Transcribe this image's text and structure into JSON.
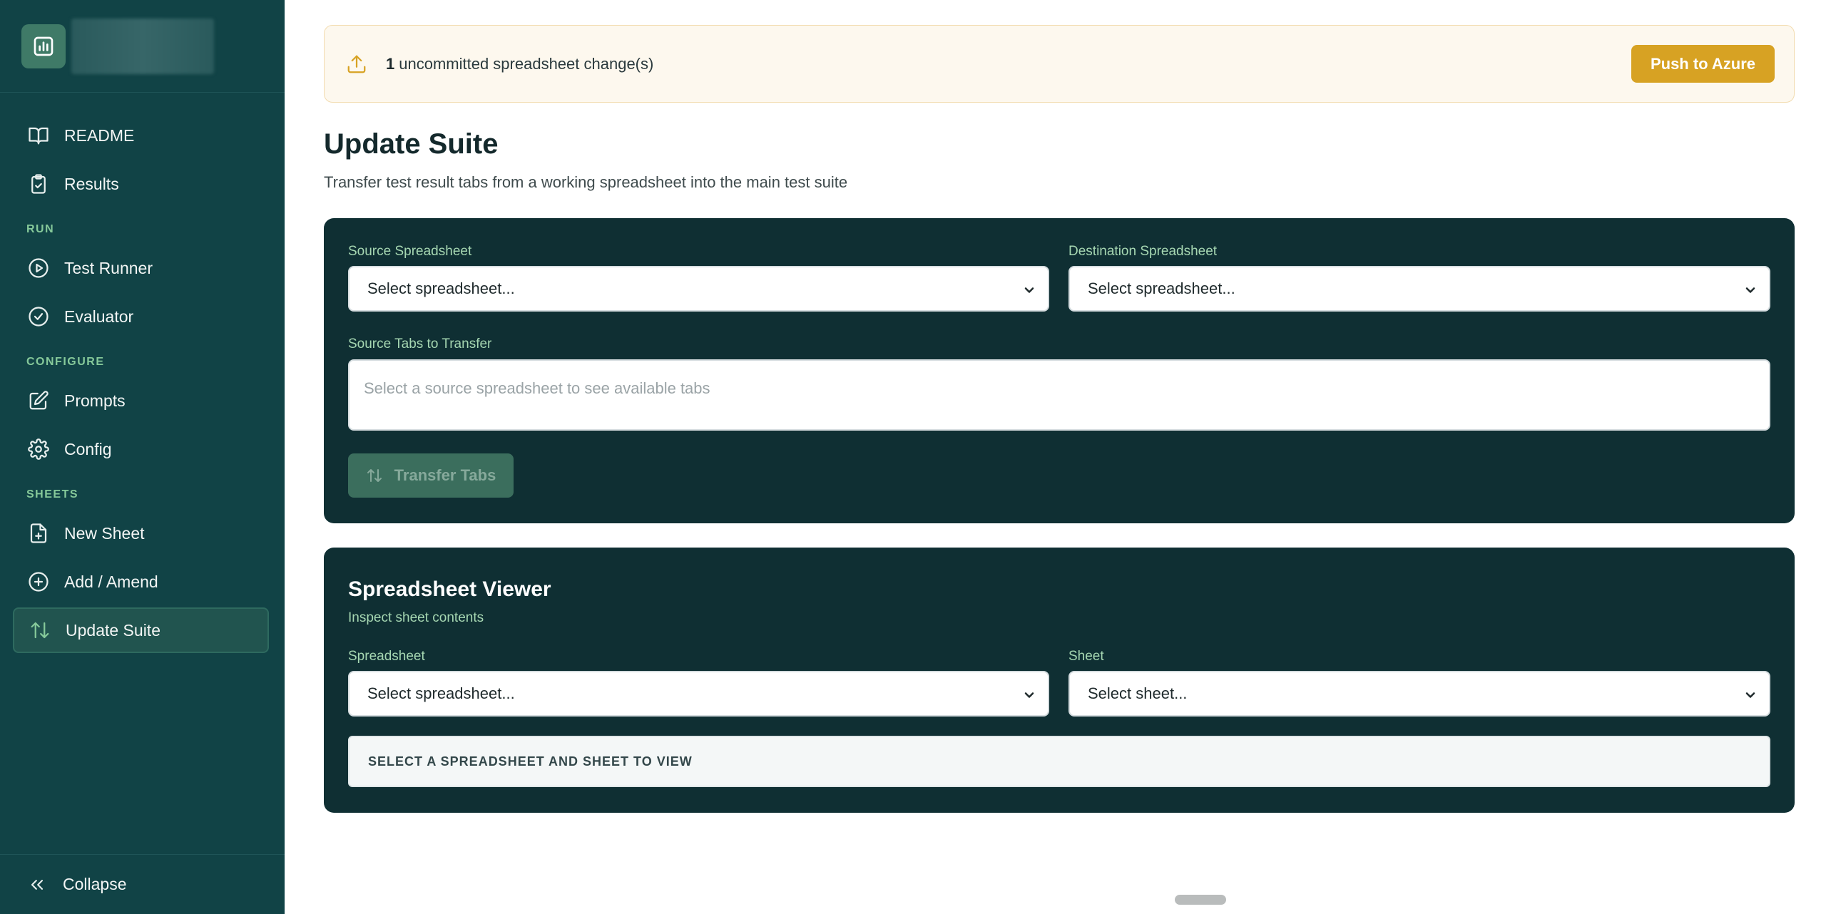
{
  "sidebar": {
    "nav_items": [
      {
        "label": "README",
        "icon": "book-icon"
      },
      {
        "label": "Results",
        "icon": "clipboard-check-icon"
      }
    ],
    "sections": [
      {
        "title": "RUN",
        "items": [
          {
            "label": "Test Runner",
            "icon": "play-circle-icon"
          },
          {
            "label": "Evaluator",
            "icon": "check-circle-icon"
          }
        ]
      },
      {
        "title": "CONFIGURE",
        "items": [
          {
            "label": "Prompts",
            "icon": "edit-icon"
          },
          {
            "label": "Config",
            "icon": "gear-icon"
          }
        ]
      },
      {
        "title": "SHEETS",
        "items": [
          {
            "label": "New Sheet",
            "icon": "file-plus-icon"
          },
          {
            "label": "Add / Amend",
            "icon": "plus-circle-icon"
          },
          {
            "label": "Update Suite",
            "icon": "arrows-up-down-icon",
            "active": true
          }
        ]
      }
    ],
    "collapse_label": "Collapse"
  },
  "banner": {
    "count": "1",
    "text": "uncommitted spreadsheet change(s)",
    "button_label": "Push to Azure"
  },
  "page": {
    "title": "Update Suite",
    "subtitle": "Transfer test result tabs from a working spreadsheet into the main test suite"
  },
  "transfer": {
    "source_label": "Source Spreadsheet",
    "source_value": "Select spreadsheet...",
    "destination_label": "Destination Spreadsheet",
    "destination_value": "Select spreadsheet...",
    "tabs_label": "Source Tabs to Transfer",
    "tabs_placeholder": "Select a source spreadsheet to see available tabs",
    "button_label": "Transfer Tabs"
  },
  "viewer": {
    "title": "Spreadsheet Viewer",
    "subtitle": "Inspect sheet contents",
    "spreadsheet_label": "Spreadsheet",
    "spreadsheet_value": "Select spreadsheet...",
    "sheet_label": "Sheet",
    "sheet_value": "Select sheet...",
    "empty_message": "SELECT A SPREADSHEET AND SHEET TO VIEW"
  },
  "colors": {
    "sidebar_bg": "#114346",
    "card_bg": "#0f2f33",
    "accent": "#d7a223",
    "label_green": "#a6d7b2"
  }
}
